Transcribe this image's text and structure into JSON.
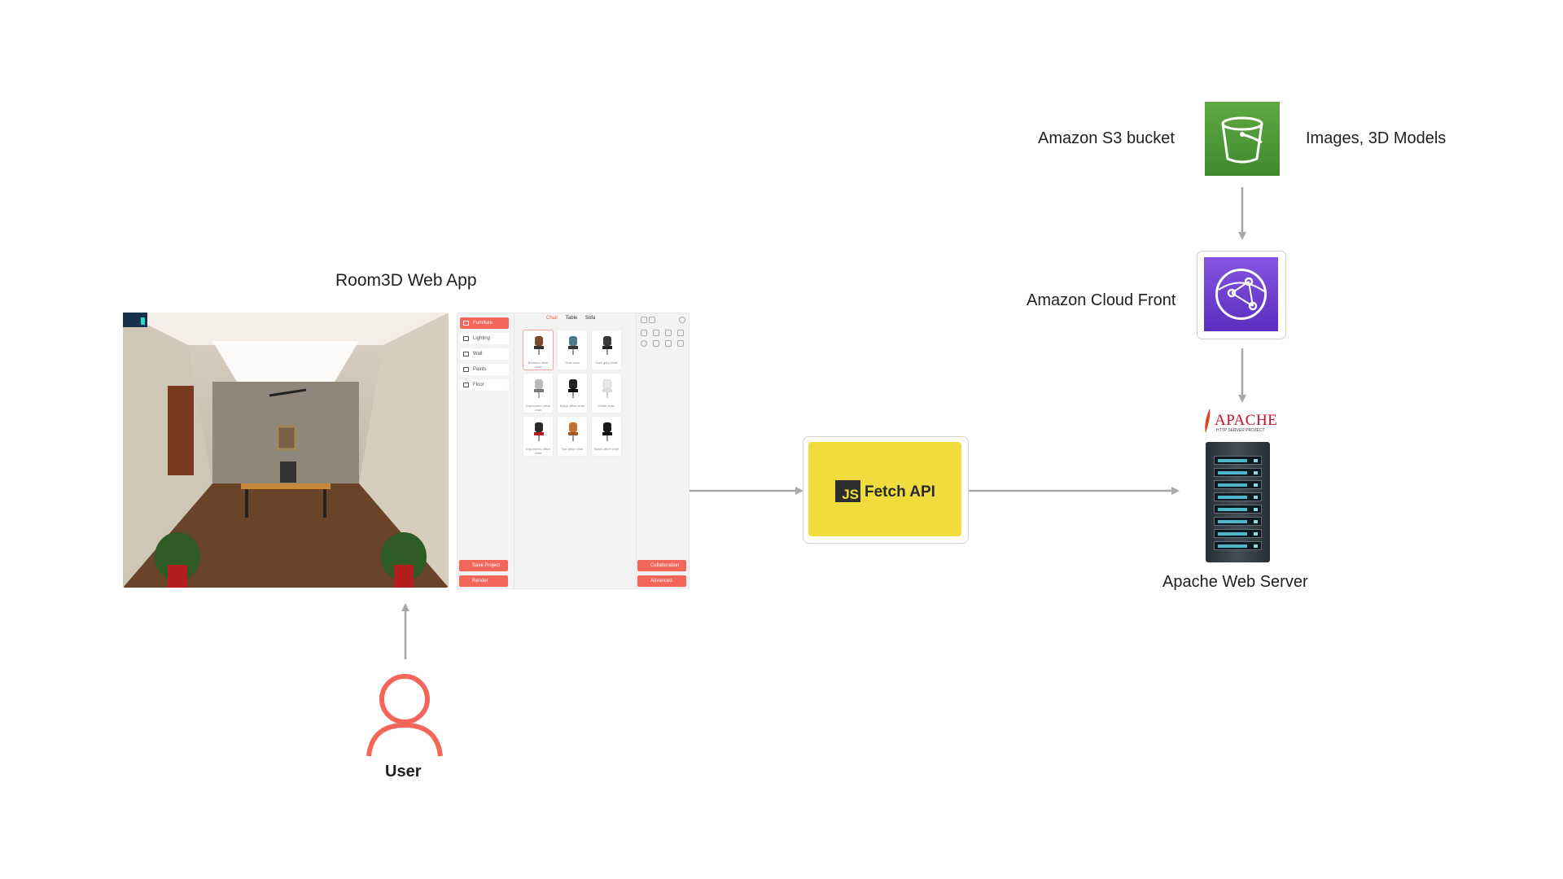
{
  "room3d": {
    "title": "Room3D Web App",
    "sidebar": [
      "Furniture",
      "Lighting",
      "Wall",
      "Paints",
      "Floor"
    ],
    "sidebar_buttons": [
      "Save Project",
      "Render"
    ],
    "tabs": [
      "Chair",
      "Table",
      "Sofa"
    ],
    "products": [
      "Bamboo desk chair",
      "Oval chair",
      "Dark grey chair",
      "Ergonomic office chair",
      "Black office chair",
      "White chair",
      "Ergonomic office chair",
      "Tan office chair",
      "Black office chair"
    ],
    "tool_buttons": [
      "Collaboration",
      "Advanced"
    ]
  },
  "fetch_api": {
    "logo": "JS",
    "label": "Fetch API"
  },
  "aws": {
    "s3_label": "Amazon S3 bucket",
    "s3_content": "Images, 3D Models",
    "cloudfront_label": "Amazon Cloud Front"
  },
  "apache": {
    "logo_text": "APACHE",
    "logo_sub": "HTTP SERVER PROJECT",
    "label": "Apache Web Server"
  },
  "user": {
    "label": "User"
  },
  "colors": {
    "accent": "#f4665a",
    "fetch_yellow": "#f0dc3c",
    "s3_green": "#4f9b3a",
    "cloudfront_purple": "#6b3fd0",
    "arrow": "#a8a8a8"
  }
}
